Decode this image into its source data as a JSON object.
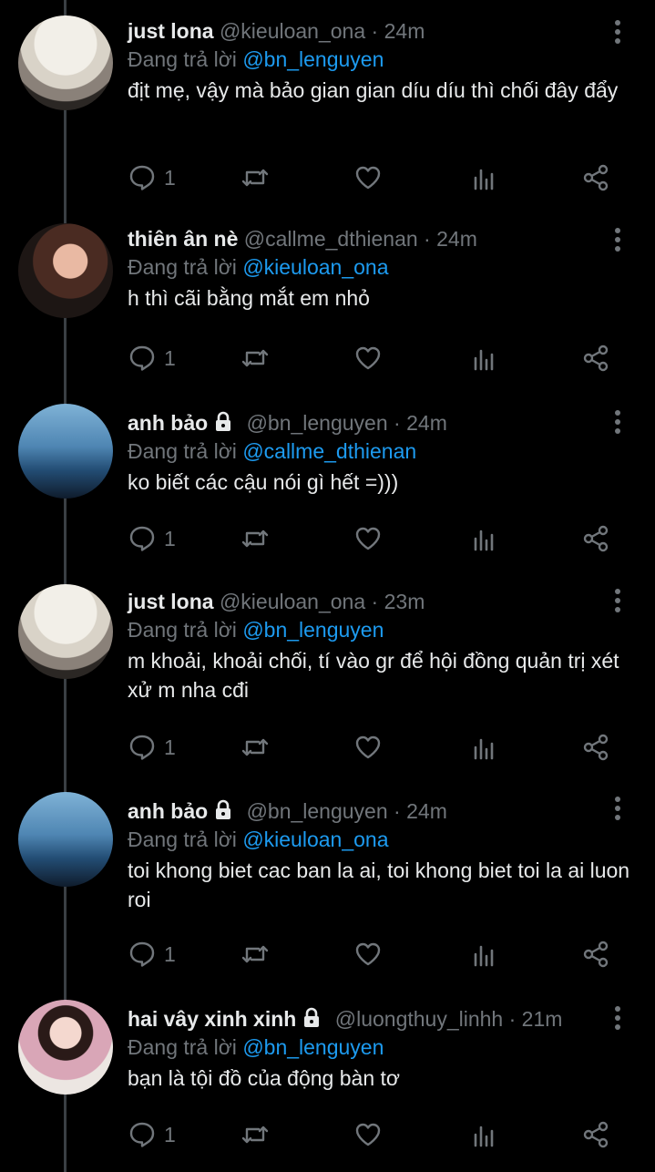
{
  "tweets": [
    {
      "name": "just lona",
      "locked": false,
      "handle": "@kieuloan_ona",
      "time": "24m",
      "reply_prefix": "Đang trả lời",
      "reply_to": "@bn_lenguyen",
      "text": "địt mẹ, vậy mà bảo gian gian díu díu thì chối đây đẩy",
      "reply_count": "1",
      "avatar": "lona"
    },
    {
      "name": "thiên ân nè",
      "locked": false,
      "handle": "@callme_dthienan",
      "time": "24m",
      "reply_prefix": "Đang trả lời",
      "reply_to": "@kieuloan_ona",
      "text": "h thì cãi bằng mắt em nhỏ",
      "reply_count": "1",
      "avatar": "thien"
    },
    {
      "name": "anh bảo",
      "locked": true,
      "handle": "@bn_lenguyen",
      "time": "24m",
      "reply_prefix": "Đang trả lời",
      "reply_to": "@callme_dthienan",
      "text": "ko biết các cậu nói gì hết =)))",
      "reply_count": "1",
      "avatar": "anh"
    },
    {
      "name": "just lona",
      "locked": false,
      "handle": "@kieuloan_ona",
      "time": "23m",
      "reply_prefix": "Đang trả lời",
      "reply_to": "@bn_lenguyen",
      "text": "m khoải, khoải chối, tí vào gr để hội đồng quản trị xét xử m nha cđi",
      "reply_count": "1",
      "avatar": "lona"
    },
    {
      "name": "anh bảo",
      "locked": true,
      "handle": "@bn_lenguyen",
      "time": "24m",
      "reply_prefix": "Đang trả lời",
      "reply_to": "@kieuloan_ona",
      "text": "toi khong biet cac ban la ai, toi khong biet toi la ai luon roi",
      "reply_count": "1",
      "avatar": "anh"
    },
    {
      "name": "hai vây xinh xinh",
      "locked": true,
      "handle": "@luongthuy_linhh",
      "time": "21m",
      "reply_prefix": "Đang trả lời",
      "reply_to": "@bn_lenguyen",
      "text": "bạn là tội đồ của động bàn tơ",
      "reply_count": "1",
      "avatar": "hai"
    }
  ],
  "icons": {
    "more": "more-vertical-icon",
    "lock": "lock-icon",
    "reply": "reply-icon",
    "retweet": "retweet-icon",
    "like": "heart-icon",
    "views": "views-icon",
    "share": "share-icon"
  },
  "colors": {
    "background": "#000000",
    "accent": "#1d9bf0",
    "muted": "#71767b",
    "text": "#e7e9ea",
    "thread_line": "#3a3f44"
  }
}
